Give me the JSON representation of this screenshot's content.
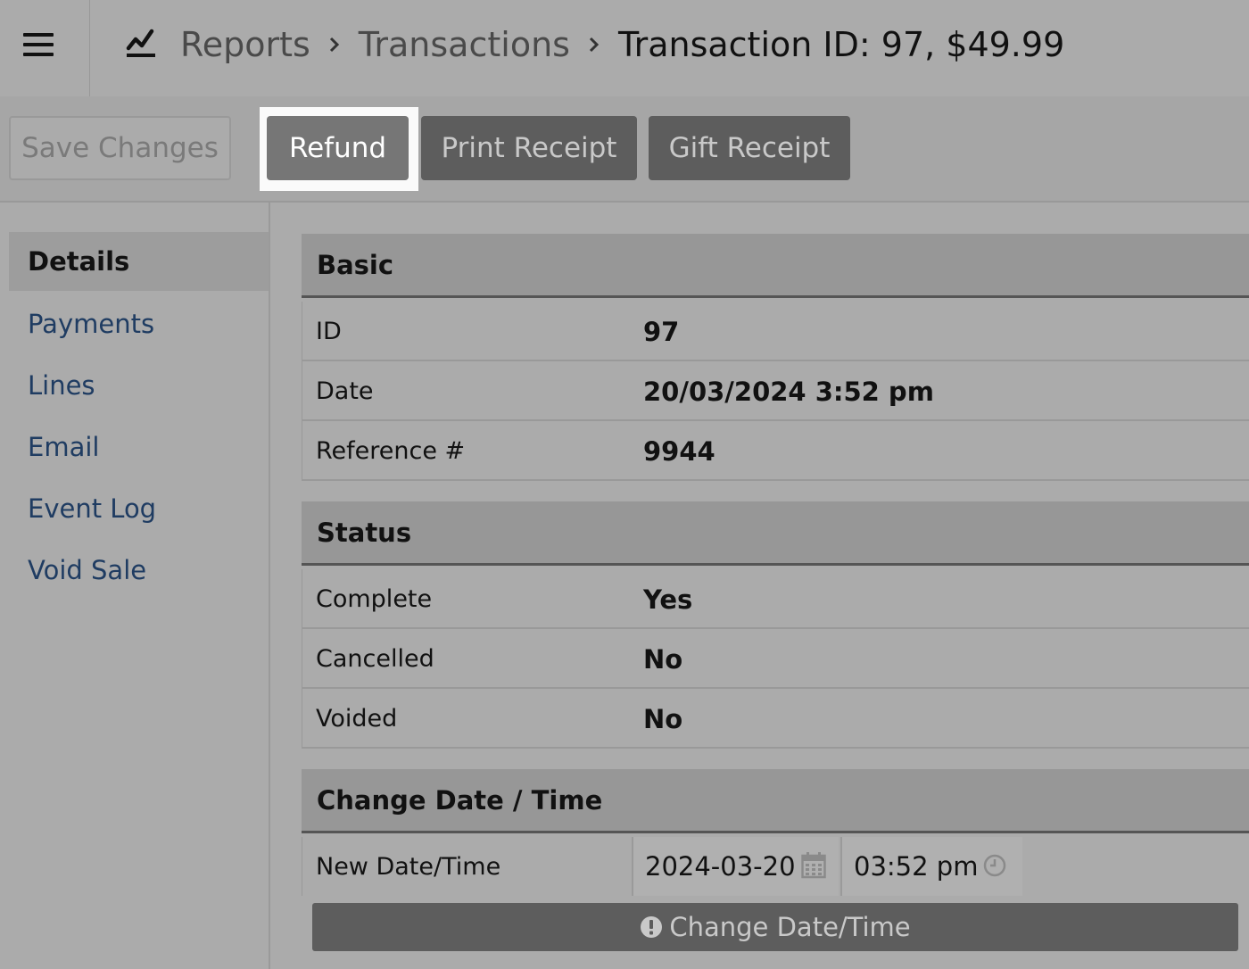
{
  "breadcrumb": {
    "items": [
      "Reports",
      "Transactions"
    ],
    "current": "Transaction ID: 97, $49.99"
  },
  "toolbar": {
    "save": "Save Changes",
    "refund": "Refund",
    "print_receipt": "Print Receipt",
    "gift_receipt": "Gift Receipt"
  },
  "sidebar": {
    "items": [
      {
        "label": "Details"
      },
      {
        "label": "Payments"
      },
      {
        "label": "Lines"
      },
      {
        "label": "Email"
      },
      {
        "label": "Event Log"
      },
      {
        "label": "Void Sale"
      }
    ]
  },
  "basic": {
    "title": "Basic",
    "rows": [
      {
        "label": "ID",
        "value": "97"
      },
      {
        "label": "Date",
        "value": "20/03/2024 3:52 pm"
      },
      {
        "label": "Reference #",
        "value": "9944"
      }
    ]
  },
  "status": {
    "title": "Status",
    "rows": [
      {
        "label": "Complete",
        "value": "Yes"
      },
      {
        "label": "Cancelled",
        "value": "No"
      },
      {
        "label": "Voided",
        "value": "No"
      }
    ]
  },
  "change_datetime": {
    "title": "Change Date / Time",
    "row_label": "New Date/Time",
    "date_value": "2024-03-20",
    "time_value": "03:52 pm",
    "button": "Change Date/Time"
  }
}
